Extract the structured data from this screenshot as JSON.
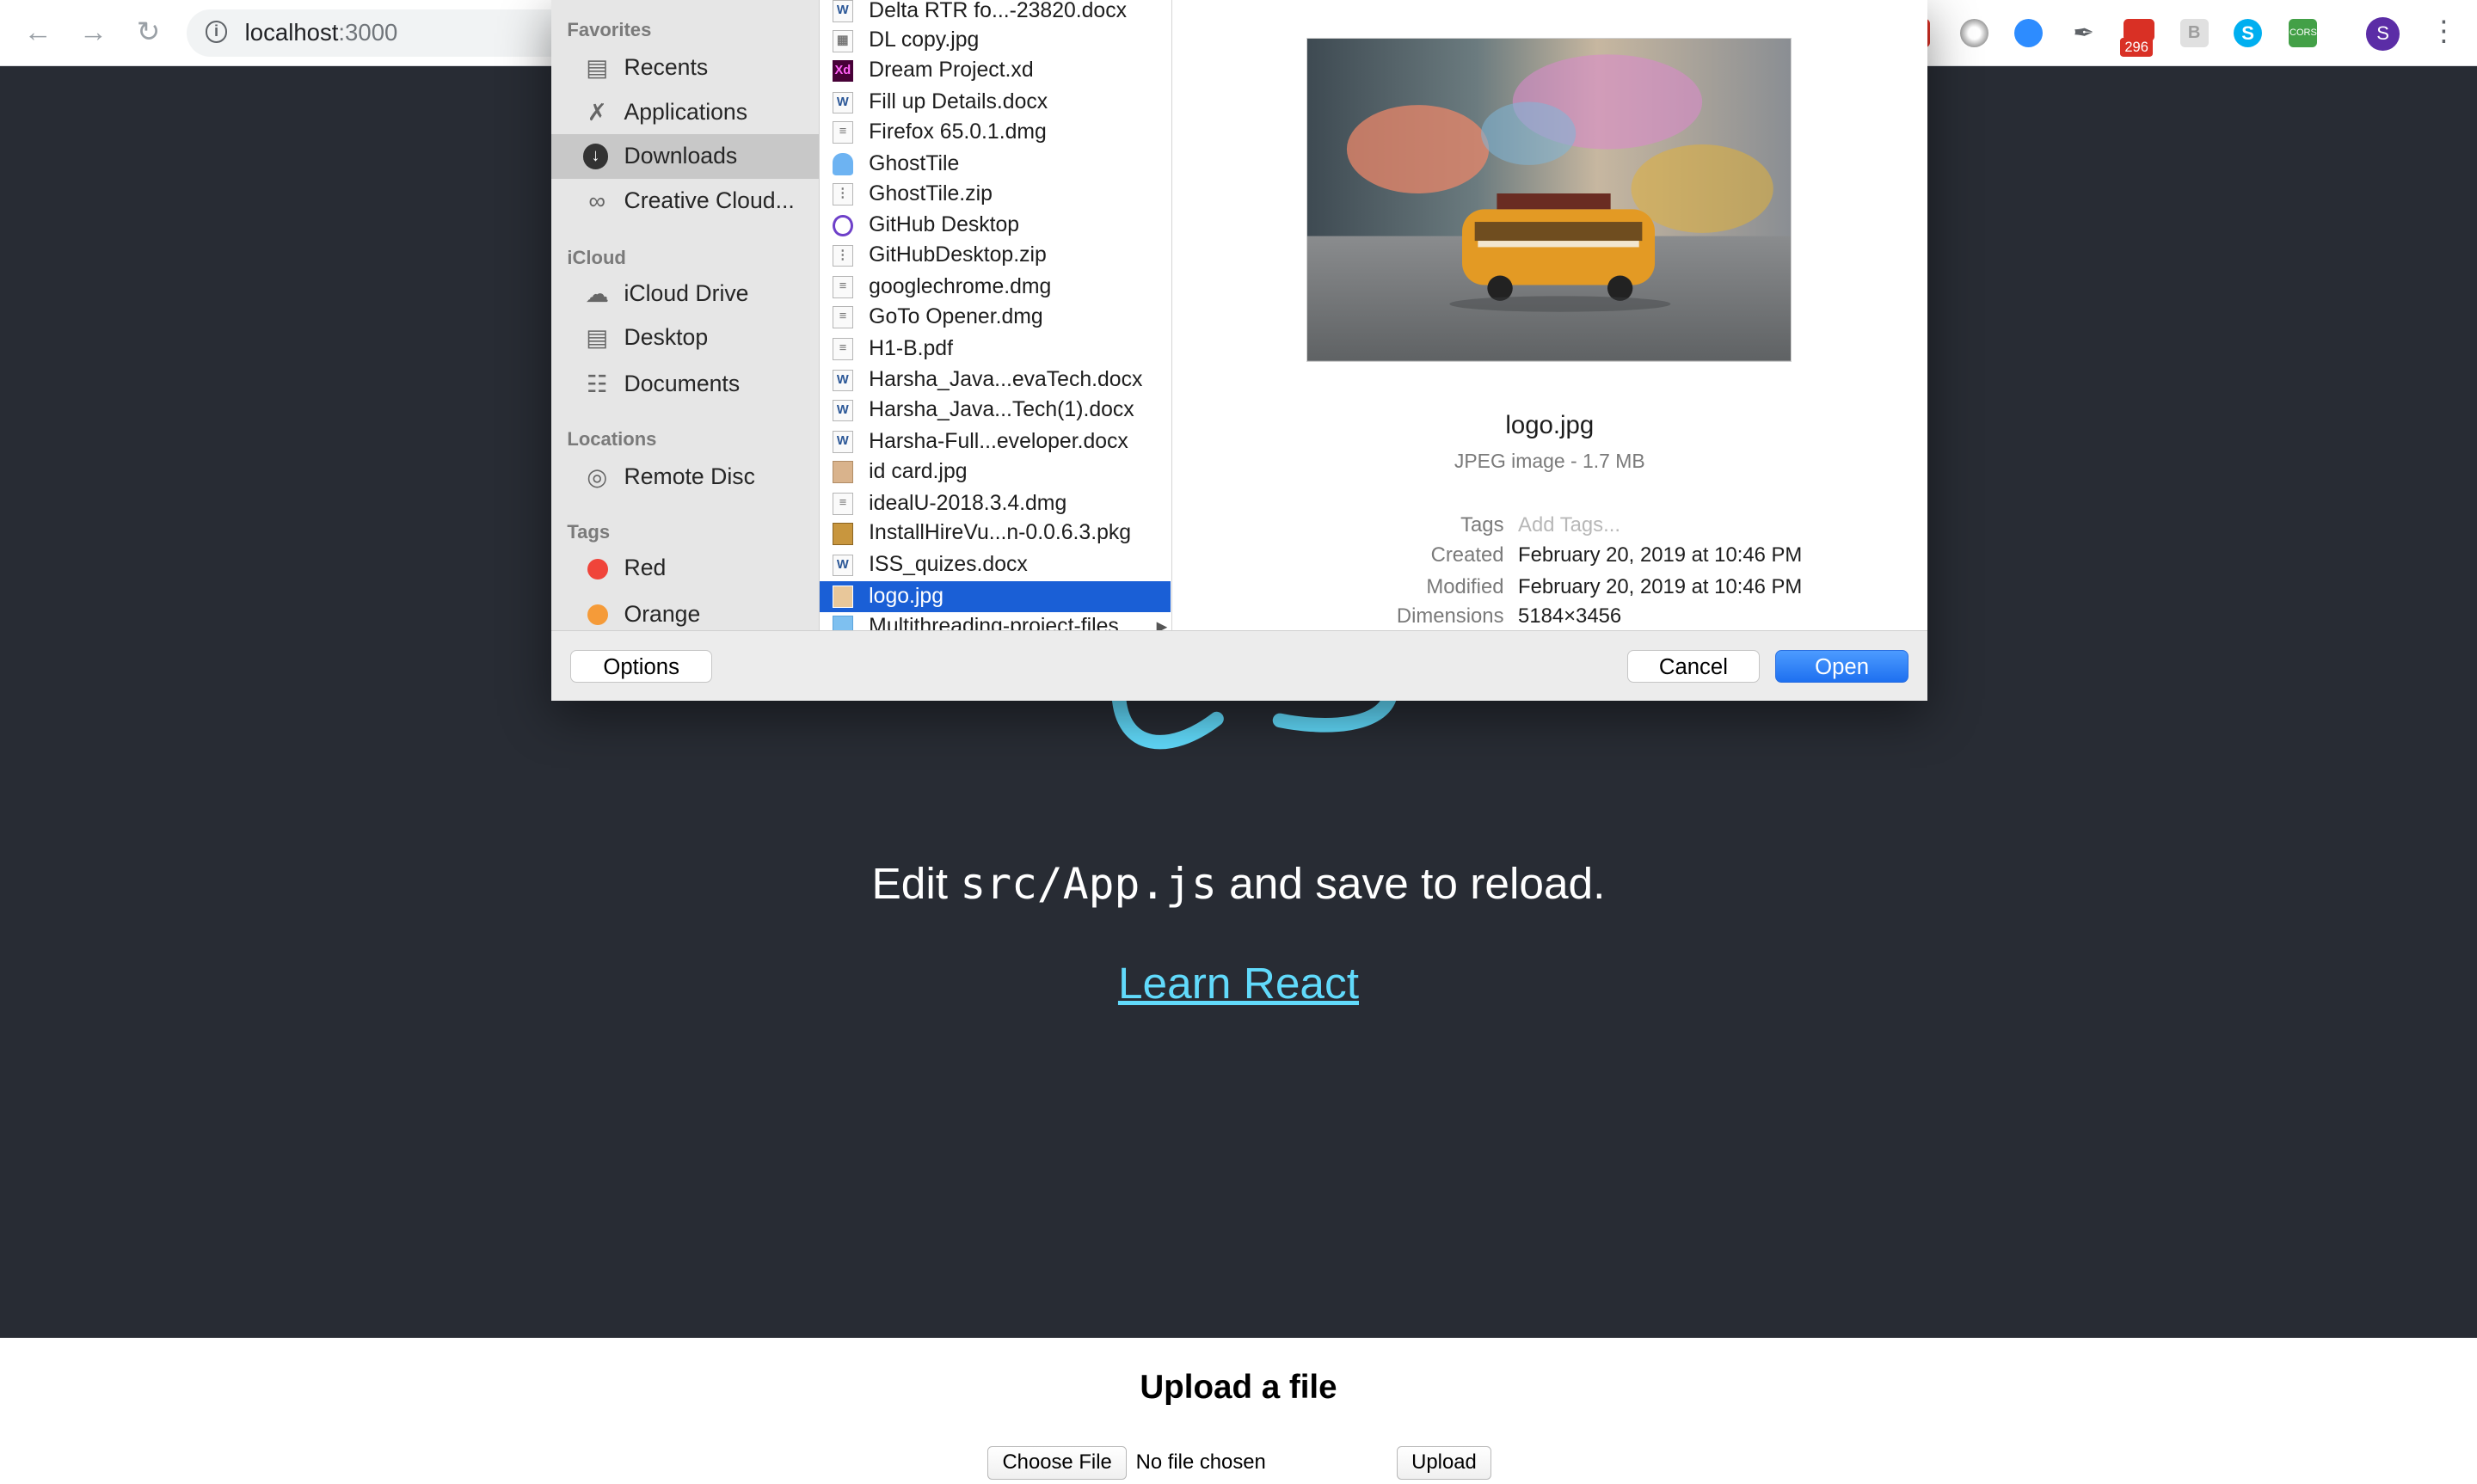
{
  "browser": {
    "url_host": "localhost",
    "url_port": ":3000",
    "gmail_badge": "296",
    "profile_initial": "S",
    "extension_icons": [
      "extension-red-icon",
      "extension-gray-circle-icon",
      "zoom-icon",
      "eyedropper-icon",
      "gmail-icon",
      "extension-b-icon",
      "skype-icon",
      "cors-icon"
    ]
  },
  "page": {
    "edit_prefix": "Edit ",
    "edit_code": "src/App.js",
    "edit_suffix": " and save to reload.",
    "learn_link": "Learn React",
    "upload_title": "Upload a file",
    "choose_file": "Choose File",
    "no_file": "No file chosen",
    "upload_button": "Upload",
    "logo_color": "#61dafb",
    "background_color": "#282c34"
  },
  "dialog": {
    "sidebar": {
      "favorites_header": "Favorites",
      "favorites": [
        {
          "label": "Recents",
          "icon": "recents-icon"
        },
        {
          "label": "Applications",
          "icon": "applications-icon"
        },
        {
          "label": "Downloads",
          "icon": "downloads-icon"
        },
        {
          "label": "Creative Cloud...",
          "icon": "creative-cloud-icon"
        }
      ],
      "icloud_header": "iCloud",
      "icloud": [
        {
          "label": "iCloud Drive",
          "icon": "cloud-icon"
        },
        {
          "label": "Desktop",
          "icon": "desktop-icon"
        },
        {
          "label": "Documents",
          "icon": "documents-icon"
        }
      ],
      "locations_header": "Locations",
      "locations": [
        {
          "label": "Remote Disc",
          "icon": "disc-icon"
        }
      ],
      "tags_header": "Tags",
      "tags": [
        {
          "label": "Red",
          "color": "#f0443a"
        },
        {
          "label": "Orange",
          "color": "#f59b39"
        }
      ]
    },
    "files": [
      "Delta RTR fo...-23820.docx",
      "DL copy.jpg",
      "Dream Project.xd",
      "Fill up Details.docx",
      "Firefox 65.0.1.dmg",
      "GhostTile",
      "GhostTile.zip",
      "GitHub Desktop",
      "GitHubDesktop.zip",
      "googlechrome.dmg",
      "GoTo Opener.dmg",
      "H1-B.pdf",
      "Harsha_Java...evaTech.docx",
      "Harsha_Java...Tech(1).docx",
      "Harsha-Full...eveloper.docx",
      "id card.jpg",
      "idealU-2018.3.4.dmg",
      "InstallHireVu...n-0.0.6.3.pkg",
      "ISS_quizes.docx",
      "logo.jpg",
      "Multithreading-project-files"
    ],
    "selected_file": "logo.jpg",
    "preview": {
      "name": "logo.jpg",
      "kind": "JPEG image - 1.7 MB",
      "tags_label": "Tags",
      "tags_placeholder": "Add Tags...",
      "created_label": "Created",
      "created_value": "February 20, 2019 at 10:46 PM",
      "modified_label": "Modified",
      "modified_value": "February 20, 2019 at 10:46 PM",
      "dimensions_label": "Dimensions",
      "dimensions_value": "5184×3456"
    },
    "options_button": "Options",
    "cancel_button": "Cancel",
    "open_button": "Open"
  }
}
